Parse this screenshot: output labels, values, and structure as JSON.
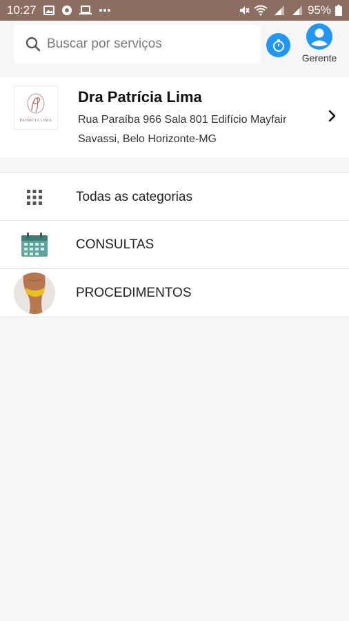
{
  "status_bar": {
    "time": "10:27",
    "battery": "95%",
    "left_icons": [
      "image-icon",
      "chrome-icon",
      "laptop-icon",
      "more-dots-icon"
    ],
    "right_icons": [
      "mute-icon",
      "wifi-icon",
      "signal-4g-icon",
      "signal-3g-icon",
      "battery-icon"
    ]
  },
  "header": {
    "search_placeholder": "Buscar por serviços",
    "account_label": "Gerente"
  },
  "clinic": {
    "name": "Dra Patrícia Lima",
    "address": "Rua Paraíba 966 Sala 801 Edifício Mayfair Savassi, Belo Horizonte-MG",
    "logo_text": "PATRÍCIA LIMA"
  },
  "categories": [
    {
      "label": "Todas as categorias",
      "icon": "grid-icon"
    },
    {
      "label": "CONSULTAS",
      "icon": "calendar-icon"
    },
    {
      "label": "PROCEDIMENTOS",
      "icon": "procedure-photo-icon"
    }
  ],
  "colors": {
    "status_bar": "#8c6f62",
    "accent": "#2196f3",
    "calendar_teal": "#4f8f86"
  }
}
